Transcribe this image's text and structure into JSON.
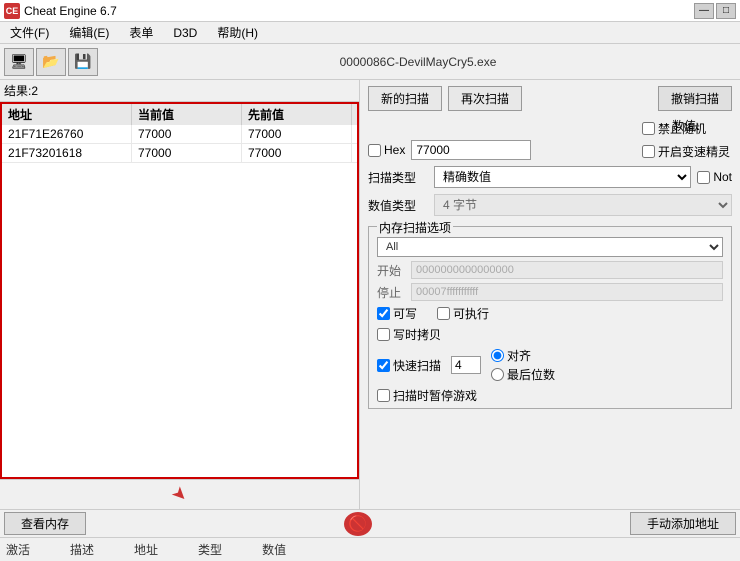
{
  "titleBar": {
    "title": "Cheat Engine 6.7",
    "minimizeLabel": "—",
    "maximizeLabel": "□",
    "icon": "CE"
  },
  "menuBar": {
    "items": [
      {
        "label": "文件(F)"
      },
      {
        "label": "编辑(E)"
      },
      {
        "label": "表单"
      },
      {
        "label": "D3D"
      },
      {
        "label": "帮助(H)"
      }
    ]
  },
  "toolbar": {
    "windowTitle": "0000086C-DevilMayCry5.exe",
    "btn1": "💾",
    "btn2": "📂",
    "btn3": "💿"
  },
  "leftPanel": {
    "resultsCount": "结果:2",
    "headers": {
      "address": "地址",
      "current": "当前值",
      "previous": "先前值"
    },
    "rows": [
      {
        "address": "21F71E26760",
        "current": "77000",
        "previous": "77000"
      },
      {
        "address": "21F73201618",
        "current": "77000",
        "previous": "77000"
      }
    ]
  },
  "rightPanel": {
    "btnNewScan": "新的扫描",
    "btnRescan": "再次扫描",
    "btnCancelScan": "撤销扫描",
    "valueLabel": "数值:",
    "hexLabel": "Hex",
    "valueInput": "77000",
    "scanTypeLabel": "扫描类型",
    "scanTypeValue": "精确数值",
    "notLabel": "Not",
    "valueTypeLabel": "数值类型",
    "valueTypeValue": "4 字节",
    "memoryGroupTitle": "内存扫描选项",
    "memoryTypeAll": "All",
    "startLabel": "开始",
    "startValue": "0000000000000000",
    "stopLabel": "停止",
    "stopValue": "00007fffffffffff",
    "writableLabel": "可写",
    "executableLabel": "可执行",
    "copyOnWriteLabel": "写时拷贝",
    "fastScanLabel": "快速扫描",
    "fastScanValue": "4",
    "alignLabel": "对齐",
    "lastDigitLabel": "最后位数",
    "pauseGameLabel": "扫描时暂停游戏",
    "noRandomLabel": "禁止随机",
    "speedHackLabel": "开启变速精灵"
  },
  "bottomToolbar": {
    "btnViewMemory": "查看内存",
    "btnManualAdd": "手动添加地址"
  },
  "statusBar": {
    "items": [
      {
        "label": "激活"
      },
      {
        "label": "描述"
      },
      {
        "label": "地址"
      },
      {
        "label": "类型"
      },
      {
        "label": "数值"
      }
    ]
  }
}
